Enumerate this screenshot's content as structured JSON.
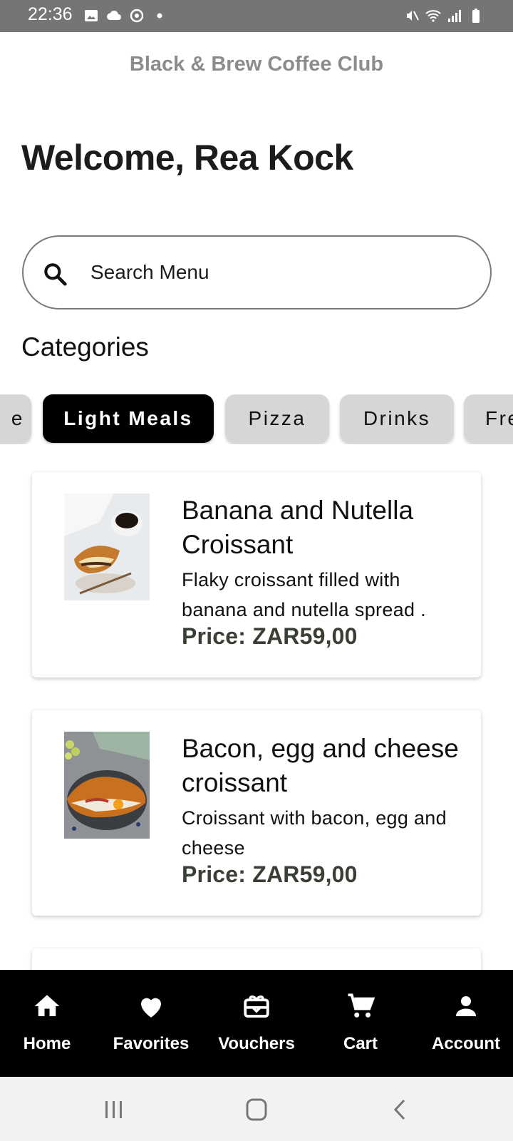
{
  "status_bar": {
    "time": "22:36",
    "left_icons": [
      "image-icon",
      "cloud-icon",
      "sync-icon",
      "dot-icon"
    ],
    "right_icons": [
      "mute-icon",
      "wifi-icon",
      "signal-icon",
      "battery-icon"
    ]
  },
  "header": {
    "app_title": "Black & Brew Coffee Club",
    "welcome": "Welcome, Rea Kock"
  },
  "search": {
    "placeholder": "Search Menu",
    "icon": "search-icon"
  },
  "categories": {
    "title": "Categories",
    "chips": [
      {
        "label": "e",
        "active": false
      },
      {
        "label": "Light Meals",
        "active": true
      },
      {
        "label": "Pizza",
        "active": false
      },
      {
        "label": "Drinks",
        "active": false
      },
      {
        "label": "Fre",
        "active": false
      }
    ]
  },
  "products": [
    {
      "name": "Banana and Nutella Croissant",
      "description": "Flaky croissant filled with banana and nutella spread .",
      "price": "Price: ZAR59,00"
    },
    {
      "name": "Bacon, egg and cheese croissant",
      "description": "Croissant with bacon, egg and cheese",
      "price": "Price: ZAR59,00"
    }
  ],
  "bottom_nav": [
    {
      "label": "Home",
      "icon": "home-icon"
    },
    {
      "label": "Favorites",
      "icon": "heart-icon"
    },
    {
      "label": "Vouchers",
      "icon": "gift-card-icon"
    },
    {
      "label": "Cart",
      "icon": "cart-icon"
    },
    {
      "label": "Account",
      "icon": "person-icon"
    }
  ],
  "system_nav": [
    "recents-icon",
    "home-circle-icon",
    "back-icon"
  ],
  "colors": {
    "status_bar": "#757575",
    "accent": "#000000",
    "chip_inactive": "#d6d6d6",
    "price_text": "#3a3f35",
    "app_title": "#8c8c8c"
  }
}
